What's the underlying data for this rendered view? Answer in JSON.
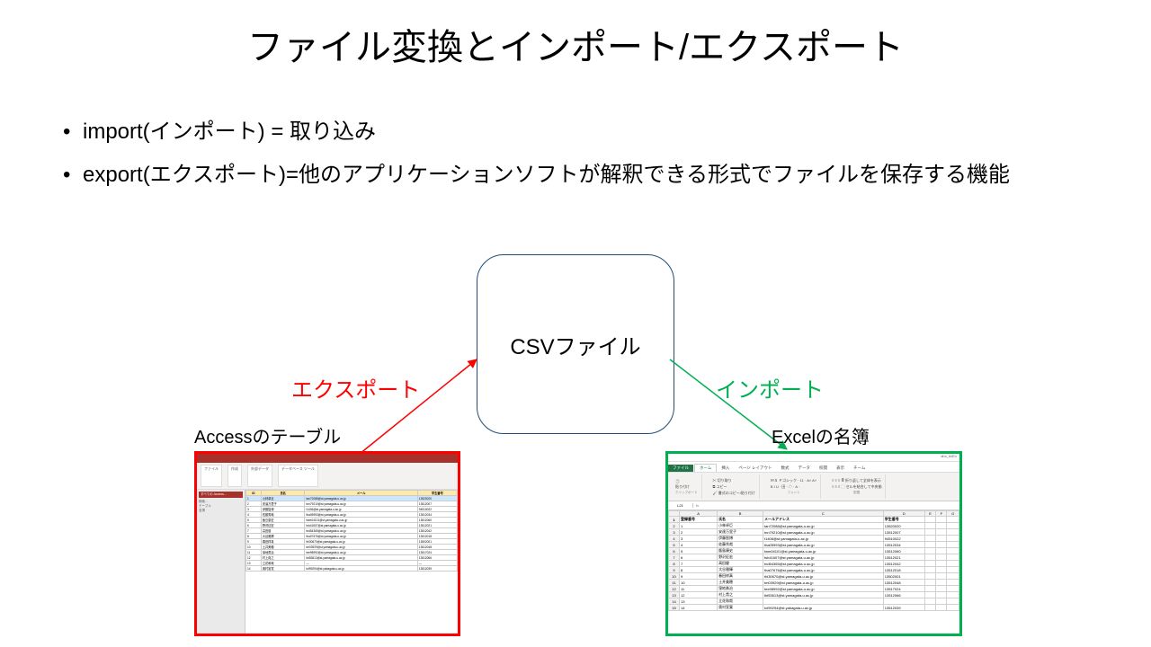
{
  "title": "ファイル変換とインポート/エクスポート",
  "bullets": [
    "import(インポート) = 取り込み",
    "export(エクスポート)=他のアプリケーションソフトが解釈できる形式でファイルを保存する機能"
  ],
  "csv_box_label": "CSVファイル",
  "labels": {
    "export": "エクスポート",
    "import": "インポート"
  },
  "captions": {
    "access": "Accessのテーブル",
    "excel": "Excelの名簿"
  },
  "access": {
    "nav_title": "すべての Access…",
    "nav_search": "検索…",
    "nav_items": [
      "テーブル",
      "名簿"
    ],
    "ribbon_tabs": [
      "ファイル",
      "作成",
      "外部データ",
      "データベース ツール"
    ],
    "columns": [
      "ID",
      "氏名",
      "メール",
      "学生番号"
    ],
    "rows": [
      [
        "1",
        "小林卓巨",
        "tan72088@st.yamagata-u.ac.jp",
        "13520020"
      ],
      [
        "2",
        "安達万里子",
        "tnn79210@st.yamagata-u.ac.jp",
        "13512007"
      ],
      [
        "3",
        "伊藤智博",
        "t1406@st.yamagata-u.ac.jp",
        "94510022"
      ],
      [
        "4",
        "佐藤秀哉",
        "tha05993@st.yamagata-u.ac.jp",
        "13512034"
      ],
      [
        "5",
        "飯島康史",
        "twm04101@st.yamagata-u.ac.jp",
        "13512060"
      ],
      [
        "6",
        "野沢征宏",
        "tsh41607@st.yamagata-u.ac.jp",
        "13512021"
      ],
      [
        "7",
        "高田健",
        "tnd54365@st.yamagata-u.ac.jp",
        "13512042"
      ],
      [
        "8",
        "大谷雅輝",
        "tha07676@st.yamagata-u.ac.jp",
        "13512018"
      ],
      [
        "9",
        "春田祥真",
        "thl30670@st.yamagata-u.ac.jp",
        "13502001"
      ],
      [
        "10",
        "土井美穂",
        "tm03929@st.yamagata-u.ac.jp",
        "13512048"
      ],
      [
        "11",
        "窪地勇治",
        "tee98992@st.yamagata-u.ac.jp",
        "13517024"
      ],
      [
        "12",
        "村上貴之",
        "tkt53613@st.yamagata-u.ac.jp",
        "13512066"
      ],
      [
        "13",
        "立花和哉",
        "—",
        "—"
      ],
      [
        "14",
        "奥村宣寛",
        "tcf99294@st.yabagata-u.ac.jp",
        "13512039"
      ]
    ]
  },
  "excel": {
    "wb_name": "dbo_tblEx",
    "file_tab": "ファイル",
    "home_tab": "ホーム",
    "other_tabs": [
      "挿入",
      "ページ レイアウト",
      "数式",
      "データ",
      "校閲",
      "表示",
      "チーム"
    ],
    "ribbon": {
      "clipboard": {
        "cut": "切り取り",
        "copy": "コピー",
        "paste_special": "書式のコピー/貼り付け",
        "group": "クリップボード",
        "paste": "貼り付け"
      },
      "font": {
        "name": "ＭＳ Ｐゴシック",
        "size": "11",
        "group": "フォント"
      },
      "align": {
        "wrap": "折り返して全体を表示",
        "merge": "セルを結合して中央揃",
        "group": "配置"
      }
    },
    "namebox": "L21",
    "fx": "fx",
    "col_letters": [
      "",
      "A",
      "B",
      "C",
      "D",
      "E",
      "F",
      "G"
    ],
    "headers": [
      "登録番号",
      "氏名",
      "メールアドレス",
      "学生番号"
    ],
    "rows": [
      [
        "1",
        "小林卓巨",
        "tan72088@st.yamagata-u.ac.jp",
        "13520020"
      ],
      [
        "2",
        "安達万里子",
        "tnn79210@st.yamagata-u.ac.jp",
        "13512007"
      ],
      [
        "3",
        "伊藤智博",
        "t1406@st.yamagata-u.ac.jp",
        "94510022"
      ],
      [
        "4",
        "佐藤秀哉",
        "tha05993@st.yamagata-u.ac.jp",
        "13512034"
      ],
      [
        "5",
        "飯島康史",
        "twm04101@st.yamagata-u.ac.jp",
        "13512060"
      ],
      [
        "6",
        "野沢征宏",
        "tsh41607@st.yamagata-u.ac.jp",
        "13512021"
      ],
      [
        "7",
        "高田健",
        "tnd54365@st.yamagata-u.ac.jp",
        "13512042"
      ],
      [
        "8",
        "大谷雅輝",
        "tha07676@st.yamagata-u.ac.jp",
        "13512018"
      ],
      [
        "9",
        "春田祥真",
        "thl30670@st.yamagata-u.ac.jp",
        "13502001"
      ],
      [
        "10",
        "土井美穂",
        "tm03929@st.yamagata-u.ac.jp",
        "13512048"
      ],
      [
        "11",
        "窪地勇治",
        "tee98992@st.yamagata-u.ac.jp",
        "13517024"
      ],
      [
        "12",
        "村上貴之",
        "tkt53613@st.yamagata-u.ac.jp",
        "13512066"
      ],
      [
        "13",
        "立花和哉",
        "",
        ""
      ],
      [
        "14",
        "奥村宣寛",
        "tcf99294@st.yabagata-u.ac.jp",
        "13512039"
      ]
    ]
  },
  "colors": {
    "export_red": "#ff0000",
    "import_green": "#00b050",
    "excel_green": "#217346",
    "access_red": "#a6302a"
  }
}
